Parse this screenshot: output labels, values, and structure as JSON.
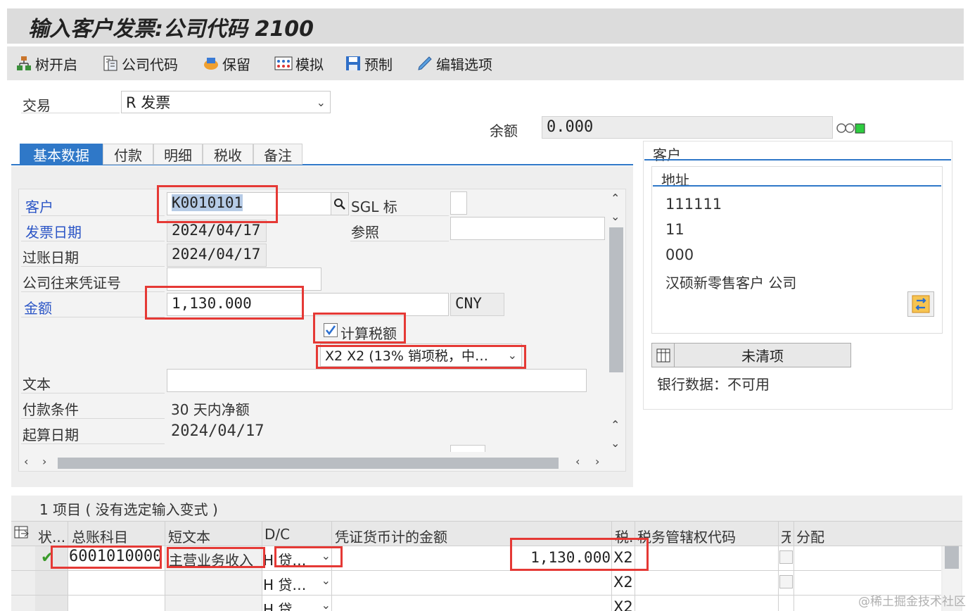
{
  "window": {
    "title": "输入客户发票:公司代码 2100"
  },
  "toolbar": {
    "tree": "树开启",
    "company_code": "公司代码",
    "hold": "保留",
    "simulate": "模拟",
    "park": "预制",
    "edit_options": "编辑选项"
  },
  "header": {
    "transaction_label": "交易",
    "transaction_value": "R 发票",
    "balance_label": "余额",
    "balance_value": "0.000"
  },
  "tabs": [
    "基本数据",
    "付款",
    "明细",
    "税收",
    "备注"
  ],
  "basic": {
    "customer_label": "客户",
    "customer_value": "K0010101",
    "sgl_label": "SGL 标",
    "invoice_date_label": "发票日期",
    "invoice_date_value": "2024/04/17",
    "reference_label": "参照",
    "posting_date_label": "过账日期",
    "posting_date_value": "2024/04/17",
    "intercompany_label": "公司往来凭证号",
    "amount_label": "金额",
    "amount_value": "1,130.000",
    "currency_value": "CNY",
    "calc_tax_label": "计算税额",
    "tax_code_value": "X2 X2 (13% 销项税，中…",
    "text_label": "文本",
    "payment_terms_label": "付款条件",
    "payment_terms_value": "30 天内净额",
    "baseline_date_label": "起算日期",
    "baseline_date_value": "2024/04/17"
  },
  "customer_panel": {
    "title": "客户",
    "address_tab": "地址",
    "lines": [
      "111111",
      "11",
      "000",
      "汉硕新零售客户 公司"
    ],
    "open_items_button": "未清项",
    "bank_data": "银行数据：不可用"
  },
  "items": {
    "header": "1 项目 ( 没有选定输入变式 )",
    "columns": [
      "状...",
      "总账科目",
      "短文本",
      "D/C",
      "凭证货币计的金额",
      "税.",
      "税务管辖权代码",
      "无",
      "分配"
    ],
    "rows": [
      {
        "status": "✔",
        "gl_account": "6001010000",
        "short_text": "主营业务收入",
        "dc": "H 贷…",
        "amount": "1,130.000",
        "tax": "X2"
      },
      {
        "status": "",
        "gl_account": "",
        "short_text": "",
        "dc": "H 贷…",
        "amount": "",
        "tax": "X2"
      },
      {
        "status": "",
        "gl_account": "",
        "short_text": "",
        "dc": "H 贷",
        "amount": "",
        "tax": "X2"
      }
    ]
  },
  "watermark": "@稀土掘金技术社区",
  "colors": {
    "accent_tab": "#2f78c8",
    "highlight": "#e53935",
    "link": "#2b55c6"
  }
}
